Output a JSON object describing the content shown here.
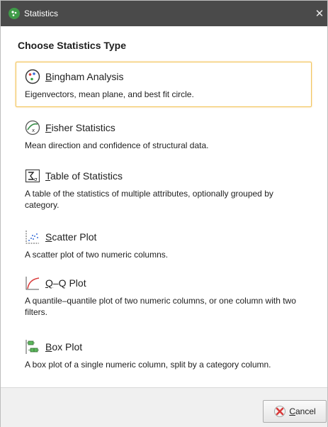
{
  "window": {
    "title": "Statistics",
    "close_glyph": "✕"
  },
  "heading": "Choose Statistics Type",
  "options": [
    {
      "title": "Bingham Analysis",
      "mnemonic": "B",
      "rest": "ingham Analysis",
      "description": "Eigenvectors, mean plane, and best fit circle.",
      "icon": "bingham-icon",
      "selected": true
    },
    {
      "title": "Fisher Statistics",
      "mnemonic": "F",
      "rest": "isher Statistics",
      "description": "Mean direction and confidence of structural data.",
      "icon": "fisher-icon",
      "selected": false
    },
    {
      "title": "Table of Statistics",
      "mnemonic": "T",
      "rest": "able of Statistics",
      "description": "A table of the statistics of multiple attributes, optionally grouped by category.",
      "icon": "table-sigma-icon",
      "selected": false
    },
    {
      "title": "Scatter Plot",
      "mnemonic": "S",
      "rest": "catter Plot",
      "description": "A scatter plot of two numeric columns.",
      "icon": "scatter-plot-icon",
      "selected": false
    },
    {
      "title": "Q–Q Plot",
      "mnemonic": "Q",
      "rest": "–Q Plot",
      "description": "A quantile–quantile plot of two numeric columns, or one column with two filters.",
      "icon": "qq-plot-icon",
      "selected": false
    },
    {
      "title": "Box Plot",
      "mnemonic": "B",
      "rest": "ox Plot",
      "description": "A box plot of a single numeric column, split by a category column.",
      "icon": "box-plot-icon",
      "selected": false
    }
  ],
  "footer": {
    "cancel_mnemonic": "C",
    "cancel_rest": "ancel",
    "cancel_icon": "cancel-icon"
  },
  "colors": {
    "titlebar": "#4a4a4a",
    "selected_border": "#f2c45a",
    "footer_bg": "#f0f0f0",
    "app_icon": "#3f9b48"
  }
}
